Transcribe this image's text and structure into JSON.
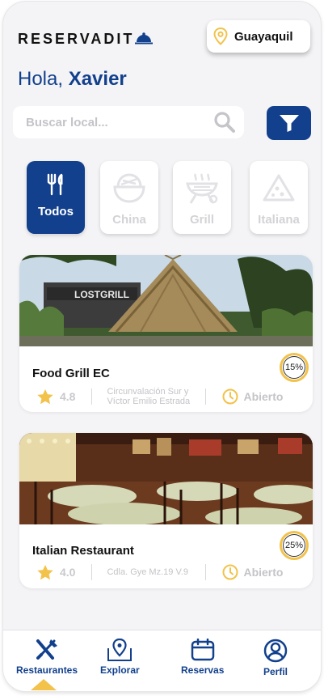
{
  "header": {
    "logo_text": "RESERVADIT",
    "location": "Guayaquil",
    "greeting_prefix": "Hola,",
    "user_name": "Xavier"
  },
  "search": {
    "placeholder": "Buscar local..."
  },
  "categories": [
    {
      "label": "Todos",
      "icon": "utensils-icon",
      "active": true
    },
    {
      "label": "China",
      "icon": "bowl-icon",
      "active": false
    },
    {
      "label": "Grill",
      "icon": "grill-icon",
      "active": false
    },
    {
      "label": "Italiana",
      "icon": "pizza-icon",
      "active": false
    }
  ],
  "restaurants": [
    {
      "name": "Food Grill EC",
      "rating": "4.8",
      "address_line1": "Circunvalación Sur y",
      "address_line2": "Víctor Emilio Estrada",
      "status": "Abierto",
      "discount": "15%",
      "sign_text": "LOSTGRILL"
    },
    {
      "name": "Italian Restaurant",
      "rating": "4.0",
      "address_line1": "Cdla. Gye Mz.19 V.9",
      "address_line2": "",
      "status": "Abierto",
      "discount": "25%"
    }
  ],
  "nav": [
    {
      "label": "Restaurantes",
      "icon": "fork-knife-icon",
      "active": true
    },
    {
      "label": "Explorar",
      "icon": "map-pin-icon",
      "active": false
    },
    {
      "label": "Reservas",
      "icon": "calendar-icon",
      "active": false
    },
    {
      "label": "Perfil",
      "icon": "user-icon",
      "active": false
    }
  ],
  "colors": {
    "primary": "#12408d",
    "accent": "#f2c24a",
    "background": "#f4f4f6"
  }
}
